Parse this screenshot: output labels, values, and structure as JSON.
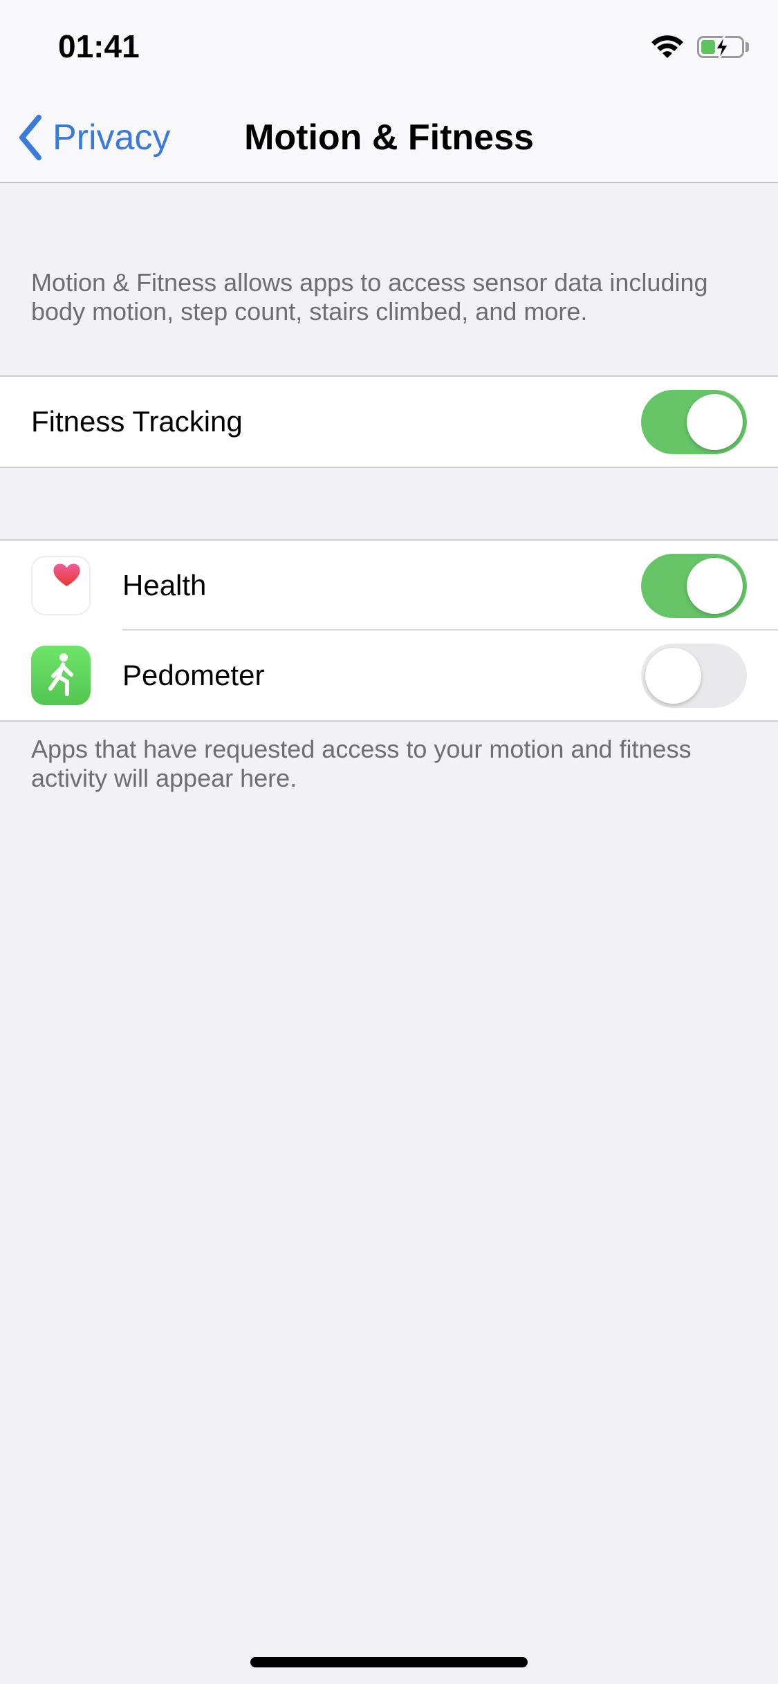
{
  "status_bar": {
    "time": "01:41",
    "wifi_icon": "wifi-icon",
    "battery_icon": "battery-charging-icon",
    "battery_level_fraction": 0.35,
    "battery_charging": true
  },
  "nav": {
    "back_label": "Privacy",
    "back_icon": "chevron-left-icon",
    "title": "Motion & Fitness"
  },
  "description": "Motion & Fitness allows apps to access sensor data including body motion, step count, stairs climbed, and more.",
  "fitness_tracking": {
    "label": "Fitness Tracking",
    "enabled": true
  },
  "apps": [
    {
      "name": "Health",
      "icon": "heart-icon",
      "enabled": true
    },
    {
      "name": "Pedometer",
      "icon": "walking-person-icon",
      "enabled": false
    }
  ],
  "footer_note": "Apps that have requested access to your motion and fitness activity will appear here.",
  "colors": {
    "accent": "#3a7ad8",
    "toggle_on": "#64c466",
    "toggle_off": "#e9e9eb",
    "background": "#f1f1f6",
    "secondary_text": "#6d6d72"
  }
}
